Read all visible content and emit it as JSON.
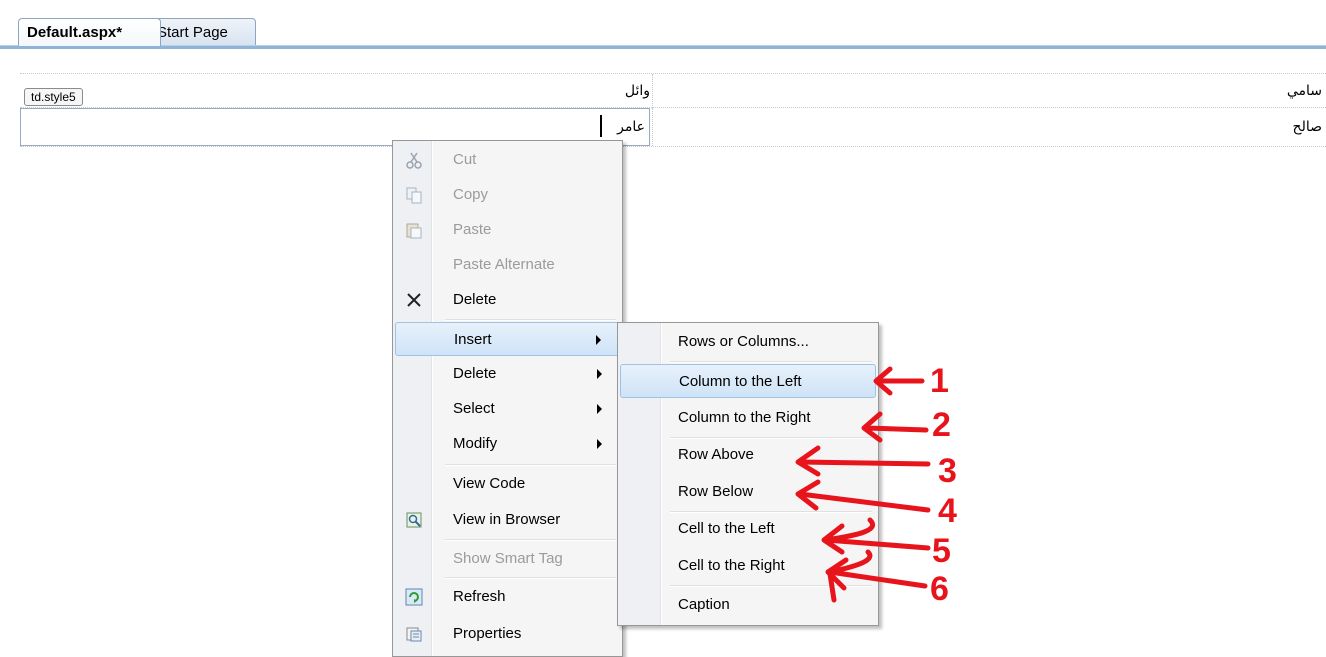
{
  "tabs": [
    {
      "label": "Default.aspx*",
      "active": true
    },
    {
      "label": "Start Page",
      "active": false
    }
  ],
  "design": {
    "tag": "td.style5",
    "rows": [
      {
        "left": "وائل",
        "right": "سامي"
      },
      {
        "left": "عامر",
        "right": "صالح"
      }
    ]
  },
  "context_menu": {
    "items": [
      {
        "label": "Cut",
        "icon": "scissors-icon",
        "disabled": true
      },
      {
        "label": "Copy",
        "icon": "copy-icon",
        "disabled": true
      },
      {
        "label": "Paste",
        "icon": "paste-icon",
        "disabled": true
      },
      {
        "label": "Paste Alternate",
        "icon": "",
        "disabled": true
      },
      {
        "label": "Delete",
        "icon": "delete-x-icon",
        "disabled": false
      },
      {
        "label": "Insert",
        "submenu": true,
        "highlighted": true
      },
      {
        "label": "Delete",
        "submenu": true
      },
      {
        "label": "Select",
        "submenu": true
      },
      {
        "label": "Modify",
        "submenu": true
      },
      {
        "label": "View Code",
        "icon": ""
      },
      {
        "label": "View in Browser",
        "icon": "view-in-browser-icon"
      },
      {
        "label": "Show Smart Tag",
        "disabled": true
      },
      {
        "label": "Refresh",
        "icon": "refresh-icon"
      },
      {
        "label": "Properties",
        "icon": "properties-icon"
      }
    ]
  },
  "insert_submenu": {
    "items": [
      {
        "label": "Rows or Columns..."
      },
      {
        "label": "Column to the Left",
        "highlighted": true
      },
      {
        "label": "Column to the Right"
      },
      {
        "label": "Row Above"
      },
      {
        "label": "Row Below"
      },
      {
        "label": "Cell to the Left"
      },
      {
        "label": "Cell to the Right"
      },
      {
        "label": "Caption"
      }
    ]
  },
  "annotations": [
    "1",
    "2",
    "3",
    "4",
    "5",
    "6"
  ],
  "colors": {
    "annotation": "#e8141c",
    "highlight": "#cfe3f7",
    "tab_border": "#8da7c3"
  }
}
